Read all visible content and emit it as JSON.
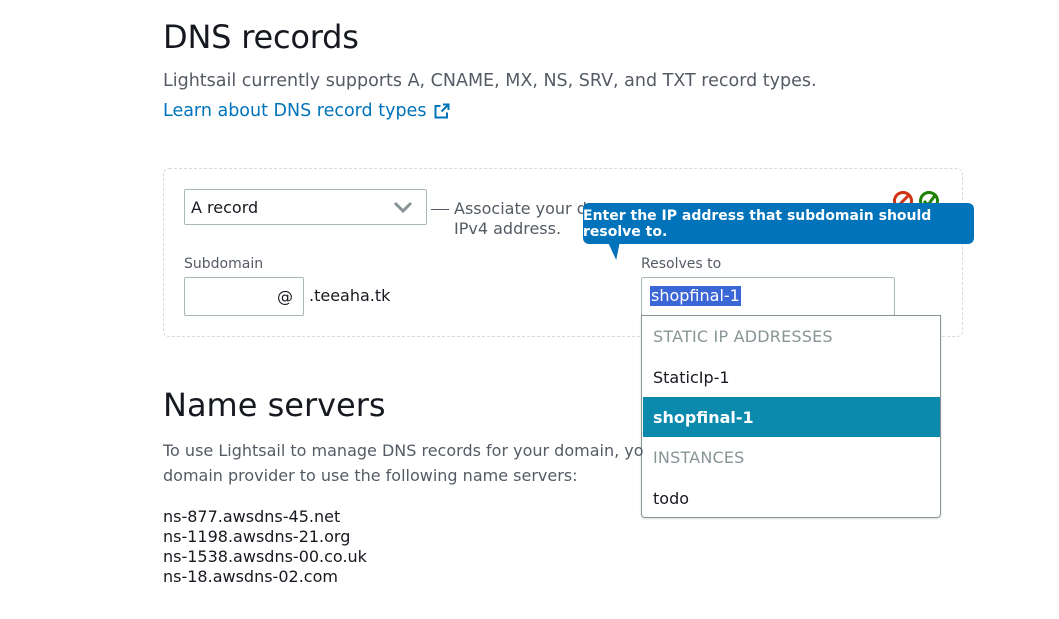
{
  "header": {
    "title": "DNS records",
    "subtitle": "Lightsail currently supports A, CNAME, MX, NS, SRV, and TXT record types.",
    "learn_link": "Learn about DNS record types"
  },
  "record": {
    "type_value": "A record",
    "assoc_text_line1": "Associate your do",
    "assoc_text_line2": "IPv4 address.",
    "subdomain_label": "Subdomain",
    "subdomain_value": "",
    "at_sign": "@",
    "domain_suffix": ".teeaha.tk",
    "resolves_label": "Resolves to",
    "resolves_value": "shopfinal-1"
  },
  "tooltip": {
    "text": "Enter the IP address that subdomain should resolve to."
  },
  "dropdown": {
    "groups": [
      {
        "label": "STATIC IP ADDRESSES",
        "items": [
          "StaticIp-1",
          "shopfinal-1"
        ]
      },
      {
        "label": "INSTANCES",
        "items": [
          "todo"
        ]
      }
    ],
    "selected": "shopfinal-1"
  },
  "name_servers": {
    "title": "Name servers",
    "desc_line1": "To use Lightsail to manage DNS records for your domain, you",
    "desc_line2": "domain provider to use the following name servers:",
    "list": [
      "ns-877.awsdns-45.net",
      "ns-1198.awsdns-21.org",
      "ns-1538.awsdns-00.co.uk",
      "ns-18.awsdns-02.com"
    ]
  },
  "colors": {
    "link": "#0073bb",
    "tooltip_bg": "#0073bb",
    "selected_item_bg": "#0b8aad",
    "text_selection": "#3b66d6",
    "error_icon": "#d13212",
    "success_icon": "#1d8102"
  }
}
